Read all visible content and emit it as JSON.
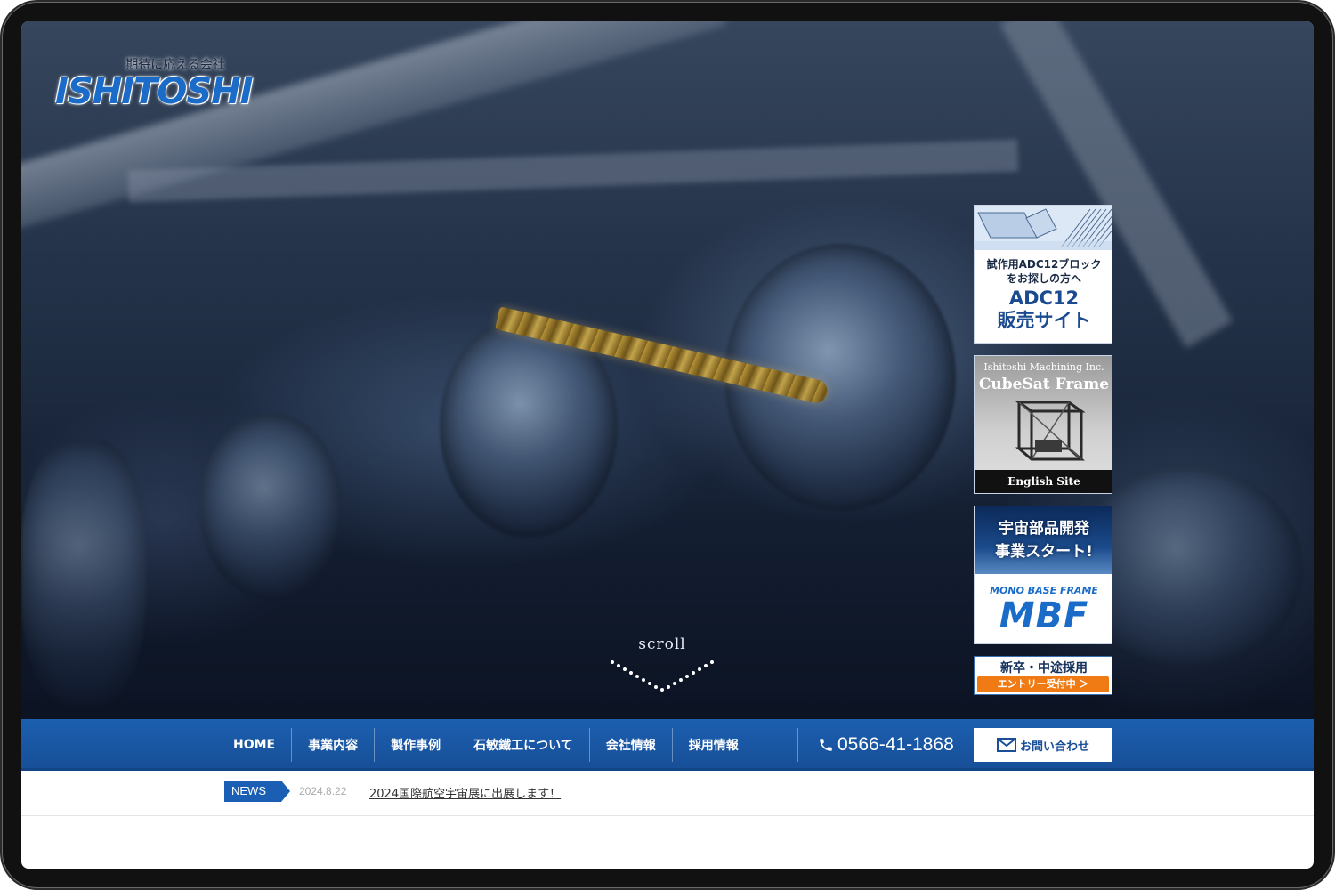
{
  "logo": {
    "tagline": "期待に応える会社",
    "wordmark": "ISHITOSHI"
  },
  "hero": {
    "scroll_label": "scroll"
  },
  "banners": {
    "adc": {
      "line1": "試作用ADC12ブロック",
      "line2": "をお探しの方へ",
      "line3": "ADC12",
      "line4": "販売サイト"
    },
    "cubesat": {
      "company": "Ishitoshi Machining Inc.",
      "title": "CubeSat Frame",
      "footer": "English Site"
    },
    "mbf": {
      "line1": "宇宙部品開発",
      "line2": "事業スタート!",
      "sub": "MONO BASE FRAME",
      "big": "MBF"
    },
    "recruit": {
      "title": "新卒・中途採用",
      "button": "エントリー受付中 ＞"
    }
  },
  "nav": {
    "items": [
      {
        "label": "HOME"
      },
      {
        "label": "事業内容"
      },
      {
        "label": "製作事例"
      },
      {
        "label": "石敏鐵工について"
      },
      {
        "label": "会社情報"
      },
      {
        "label": "採用情報"
      }
    ],
    "phone": "0566-41-1868",
    "contact_label": "お問い合わせ"
  },
  "news": {
    "tag": "NEWS",
    "date": "2024.8.22",
    "title": "2024国際航空宇宙展に出展します！"
  },
  "colors": {
    "brand_blue": "#1a5fb4",
    "accent_orange": "#f07a14"
  }
}
